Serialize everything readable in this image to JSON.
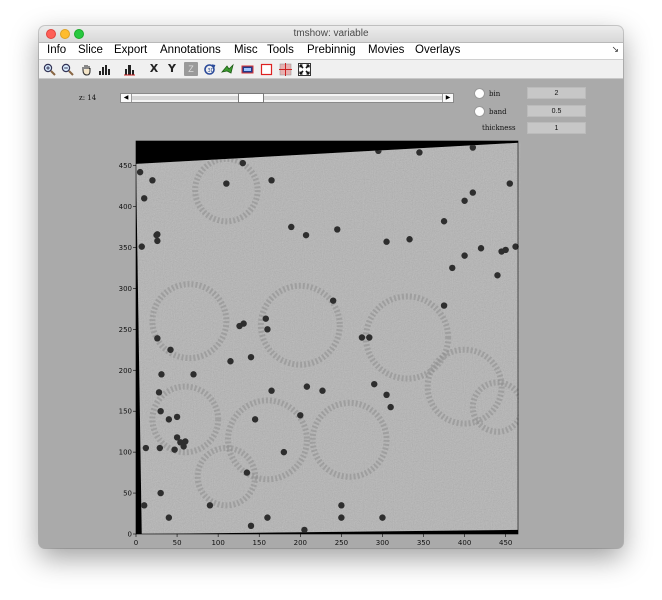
{
  "window": {
    "title": "tmshow: variable"
  },
  "menu": [
    "Info",
    "Slice",
    "Export",
    "Annotations",
    "Misc",
    "Tools",
    "Prebinnig",
    "Movies",
    "Overlays"
  ],
  "toolbar": {
    "icons": [
      "zoom-in-icon",
      "zoom-out-icon",
      "pan-hand-icon",
      "histogram-icon",
      "contrast-icon",
      "x-axis-button",
      "y-axis-button",
      "z-axis-button",
      "rotate-icon",
      "flip-icon",
      "region-icon",
      "select-box-icon",
      "crosshair-icon",
      "fit-icon"
    ],
    "x_label": "X",
    "y_label": "Y",
    "z_label": "Z"
  },
  "slice": {
    "label": "z: 14",
    "value_fraction": 0.37
  },
  "params": {
    "bin_label": "bin",
    "bin_value": "2",
    "band_label": "band",
    "band_value": "0.5",
    "thickness_label": "thickness",
    "thickness_value": "1"
  },
  "plot": {
    "x_ticks": [
      "0",
      "50",
      "100",
      "150",
      "200",
      "250",
      "300",
      "350",
      "400",
      "450"
    ],
    "y_ticks": [
      "0",
      "50",
      "100",
      "150",
      "200",
      "250",
      "300",
      "350",
      "400",
      "450"
    ],
    "xlim": [
      0,
      465
    ],
    "ylim": [
      0,
      480
    ],
    "colors": {
      "background": "#000000",
      "sample": "#b4b4b4",
      "particle": "#2e2e2e",
      "frame": "#aaaaaa"
    }
  }
}
